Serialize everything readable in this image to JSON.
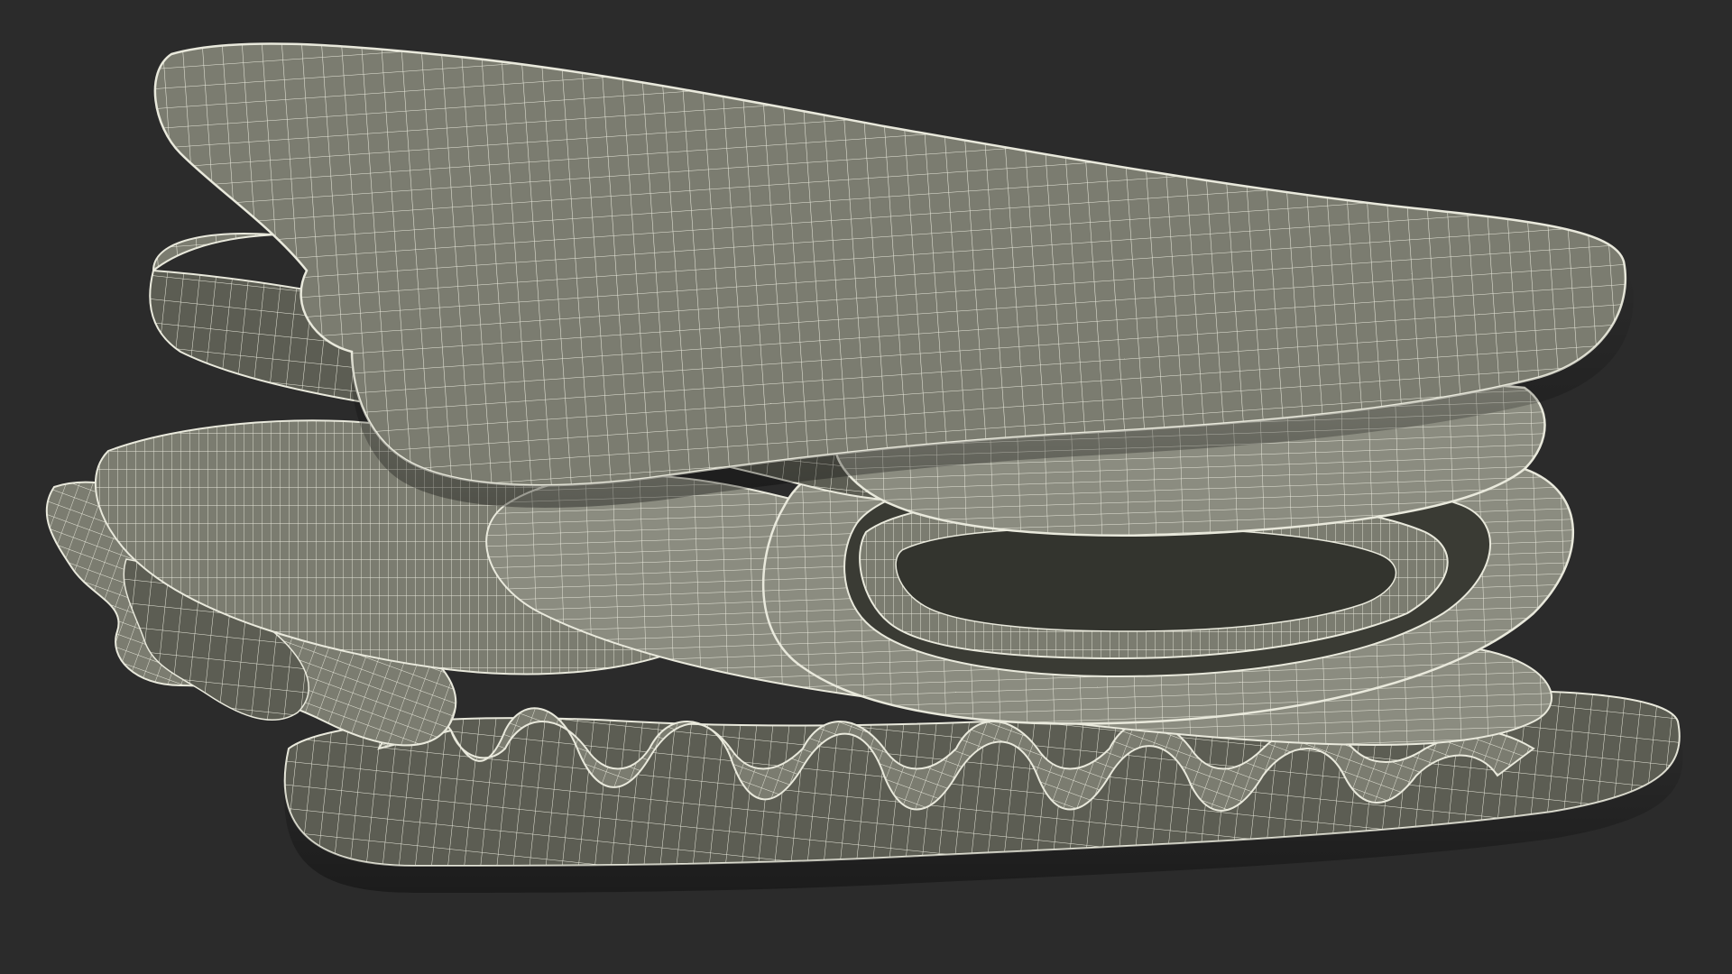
{
  "scene": {
    "subject_icon": "sandwich-wireframe-render",
    "colors": {
      "background": "#2b2b2b",
      "surface": "#7b7c70",
      "surface_light": "#8b8c80",
      "surface_dark": "#5c5d53",
      "wire": "#e9e9dc",
      "shadow": "#3c3d36"
    }
  }
}
